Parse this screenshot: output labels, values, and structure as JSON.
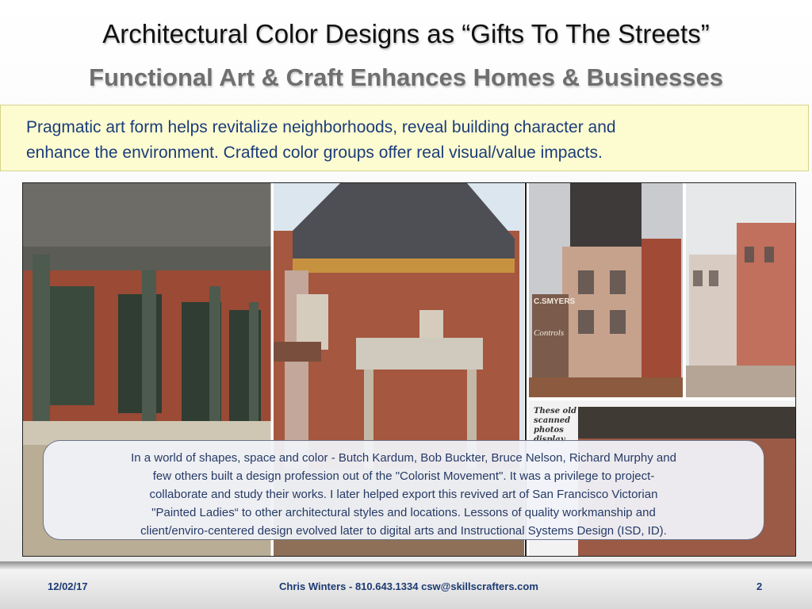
{
  "title": "Architectural Color Designs as “Gifts To The Streets”",
  "subtitle": "Functional Art & Craft Enhances Homes & Businesses",
  "callout": {
    "line1": "Pragmatic art form helps revitalize neighborhoods, reveal building character and",
    "line2": "enhance the environment.  Crafted color groups offer real visual/value impacts."
  },
  "photo_text": {
    "sign1": "C.SMYERS",
    "sign2": "Controls",
    "scan_note": "These old scanned photos display"
  },
  "bubble": {
    "line1": "In a world of shapes, space and color - Butch Kardum, Bob Buckter, Bruce Nelson, Richard Murphy and",
    "line2": "few others built a design profession out of the \"Colorist Movement\".  It was a privilege to project-",
    "line3": "collaborate and study their works.  I later helped export this revived art of San Francisco Victorian",
    "line4": "\"Painted Ladies“ to other architectural styles and locations.  Lessons of quality workmanship and",
    "line5": "client/enviro-centered design evolved later to digital arts and Instructional  Systems Design (ISD, ID)."
  },
  "footer": {
    "date": "12/02/17",
    "contact": "Chris Winters - 810.643.1334 csw@skillscrafters.com",
    "page": "2"
  }
}
